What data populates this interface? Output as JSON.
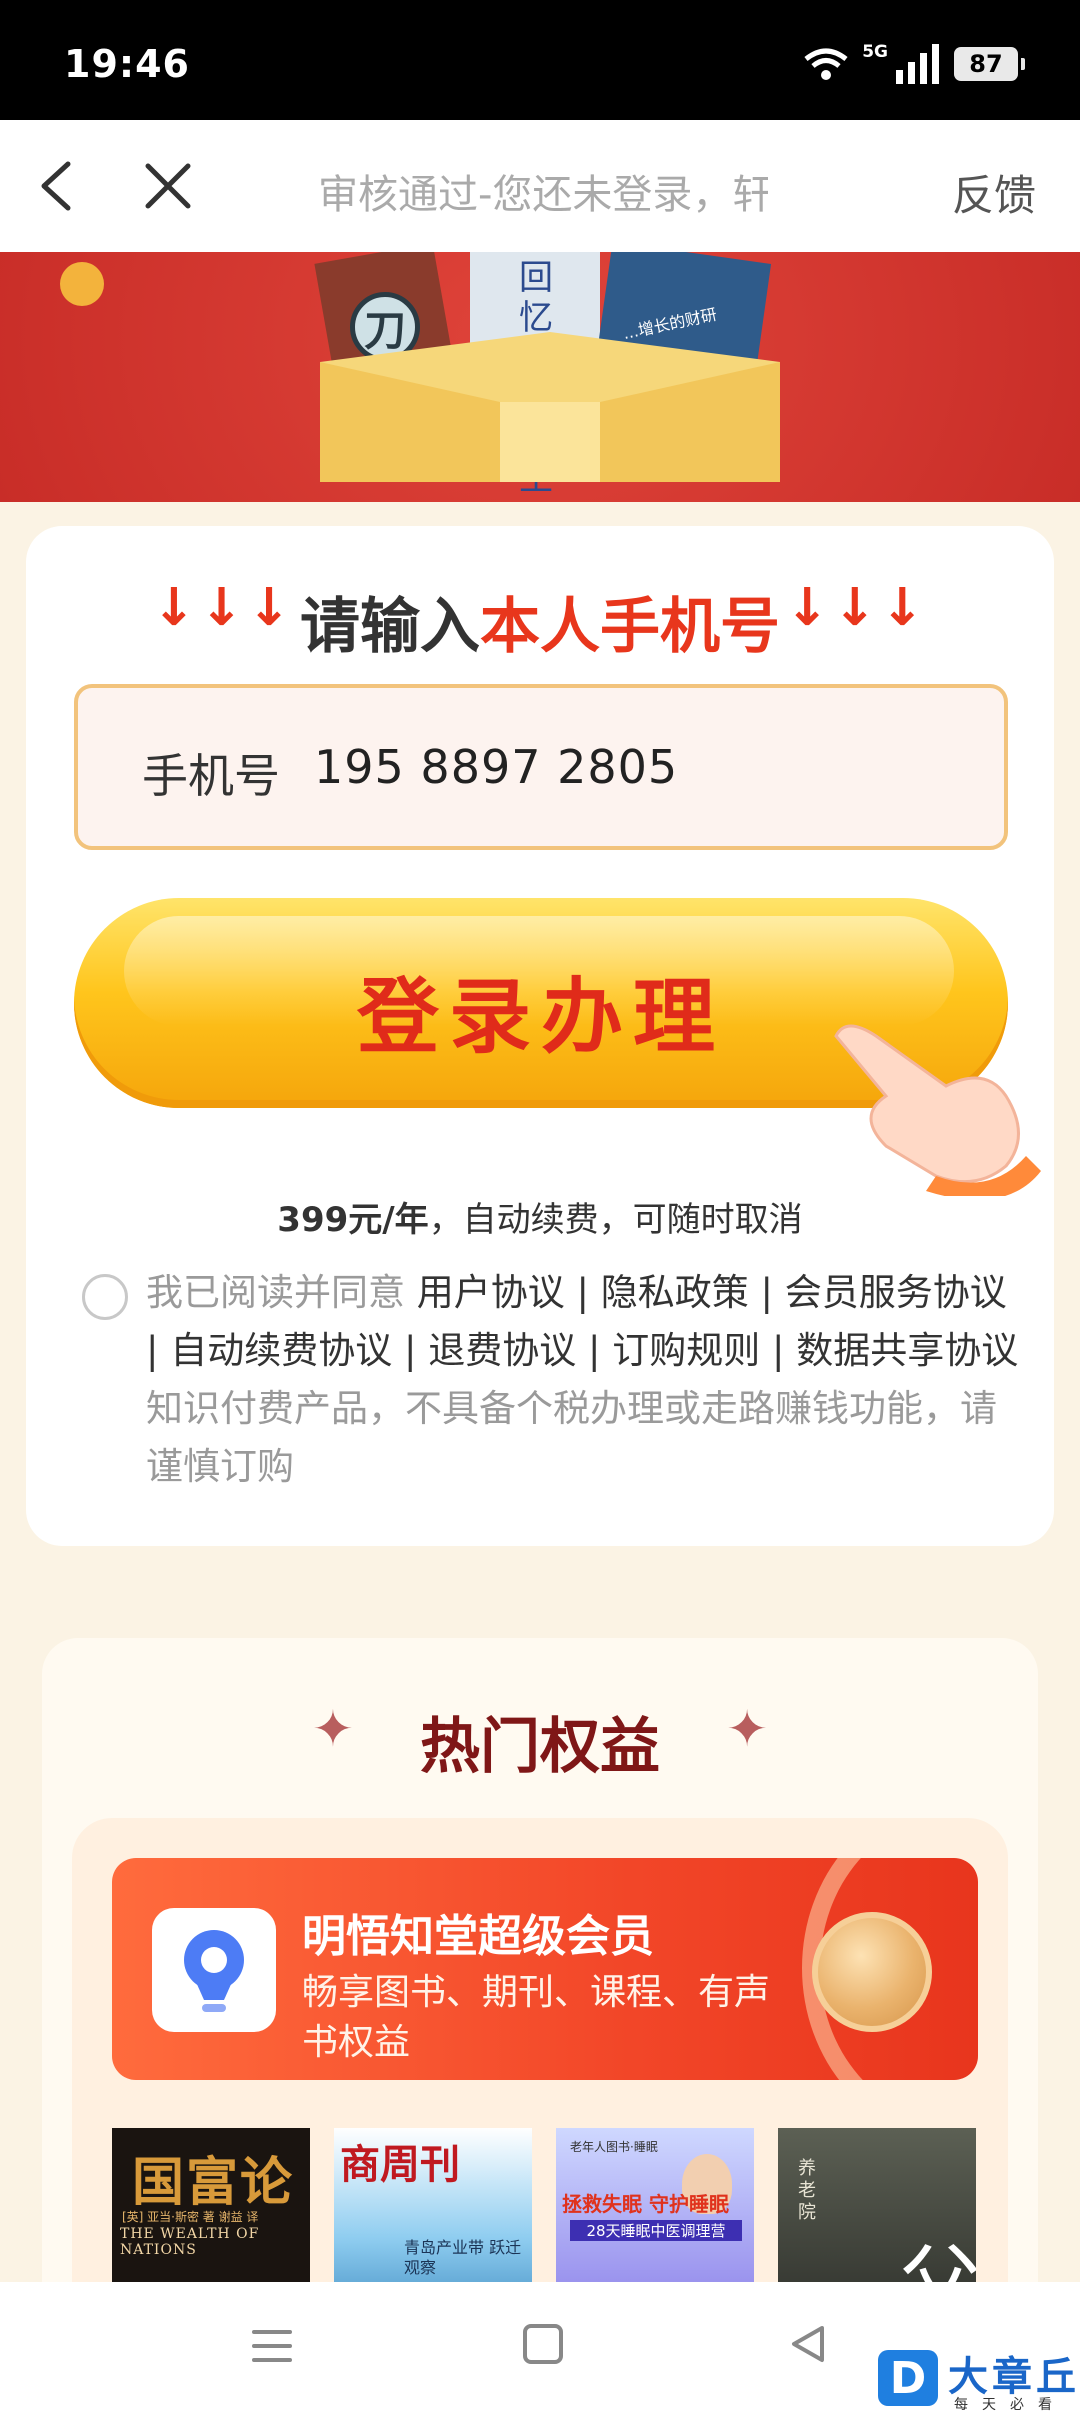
{
  "status_bar": {
    "time": "19:46",
    "network": "5G",
    "battery": "87",
    "icons": [
      "wifi-icon",
      "signal-icon",
      "battery-icon"
    ]
  },
  "nav": {
    "title": "审核通过-您还未登录，轩",
    "feedback": "反馈",
    "icons": [
      "back-icon",
      "close-icon"
    ]
  },
  "banner": {
    "book_title": "回忆鲁迅先生",
    "badge_glyph": "刀",
    "book_subtitle": "...增长的财研"
  },
  "login": {
    "arrows": "↓↓↓",
    "heading_prefix": "请输入",
    "heading_highlight": "本人手机号",
    "phone_label": "手机号",
    "phone_value": "195 8897 2805",
    "button_label": "登录办理",
    "price_bold": "399元/年",
    "price_rest": "，自动续费，可随时取消",
    "agree_prefix": "我已阅读并同意 ",
    "agree_links": "用户协议 | 隐私政策 | 会员服务协议 | 自动续费协议 | 退费协议 | 订购规则 | 数据共享协议",
    "agree_suffix": " 知识付费产品，不具备个税办理或走路赚钱功能，请谨慎订购"
  },
  "benefits": {
    "title": "热门权益",
    "sparkle": "✦",
    "member_title": "明悟知堂超级会员",
    "member_desc": "畅享图书、期刊、课程、有声书权益",
    "covers": [
      {
        "title": "国富论",
        "subtitle": "[英] 亚当·斯密 著 谢益 译",
        "english": "THE WEALTH OF NATIONS"
      },
      {
        "title": "商周刊",
        "subtitle": "青岛产业带 跃迁观察"
      },
      {
        "title": "老年人图书·睡眠",
        "subtitle": "拯救失眠 守护睡眠",
        "tag": "28天睡眠中医调理营"
      },
      {
        "title": "父",
        "subtitle": "养老院"
      }
    ]
  },
  "bottom_nav": {
    "icons": [
      "menu-icon",
      "home-icon",
      "back-icon"
    ]
  },
  "watermark": {
    "logo": "D",
    "name": "大章丘",
    "sub": "每天必看"
  }
}
